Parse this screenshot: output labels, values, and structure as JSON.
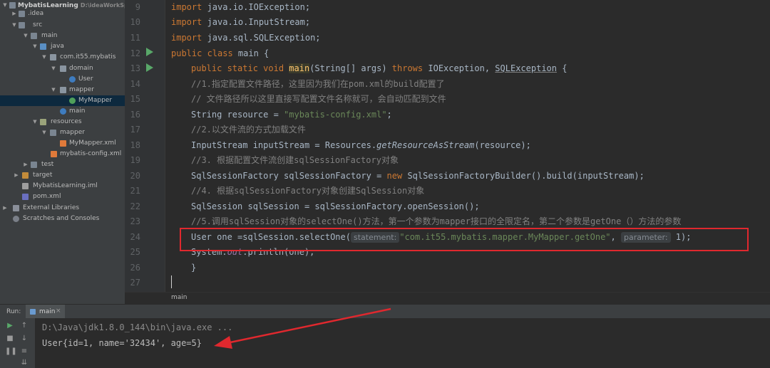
{
  "project_tree": {
    "items": [
      {
        "label": "MybatisLearning",
        "sub": "D:\\ideaWorkSp",
        "icon": "folder-icon"
      },
      {
        "label": ".idea",
        "icon": "folder-icon"
      },
      {
        "label": "src",
        "icon": "folder-icon"
      },
      {
        "label": "main",
        "icon": "folder-icon"
      },
      {
        "label": "java",
        "icon": "source-folder-icon"
      },
      {
        "label": "com.it55.mybatis",
        "icon": "package-icon"
      },
      {
        "label": "domain",
        "icon": "package-icon"
      },
      {
        "label": "User",
        "icon": "class-icon"
      },
      {
        "label": "mapper",
        "icon": "package-icon"
      },
      {
        "label": "MyMapper",
        "icon": "interface-icon"
      },
      {
        "label": "main",
        "icon": "class-icon"
      },
      {
        "label": "resources",
        "icon": "resources-folder-icon"
      },
      {
        "label": "mapper",
        "icon": "folder-icon"
      },
      {
        "label": "MyMapper.xml",
        "icon": "xml-file-icon"
      },
      {
        "label": "mybatis-config.xml",
        "icon": "xml-file-icon"
      },
      {
        "label": "test",
        "icon": "folder-icon"
      },
      {
        "label": "target",
        "icon": "excluded-folder-icon"
      },
      {
        "label": "MybatisLearning.iml",
        "icon": "iml-file-icon"
      },
      {
        "label": "pom.xml",
        "icon": "maven-file-icon"
      },
      {
        "label": "External Libraries",
        "icon": "library-icon"
      },
      {
        "label": "Scratches and Consoles",
        "icon": "scratch-icon"
      }
    ]
  },
  "editor": {
    "line_numbers": [
      "9",
      "10",
      "11",
      "12",
      "13",
      "14",
      "15",
      "16",
      "17",
      "18",
      "19",
      "20",
      "21",
      "22",
      "23",
      "24",
      "25",
      "26",
      "27"
    ],
    "code": {
      "l9_kw": "import",
      "l9_rest": " java.io.IOException;",
      "l10_kw": "import",
      "l10_rest": " java.io.InputStream;",
      "l11_kw": "import",
      "l11_rest": " java.sql.SQLException;",
      "l12_kw": "public class",
      "l12_rest": " main {",
      "l13_kw": "public static void",
      "l13_method": "main",
      "l13_params": "(String[] args) ",
      "l13_throws": "throws",
      "l13_exc1": " IOException, ",
      "l13_exc2": "SQLException",
      "l13_end": " {",
      "l14": "//1.指定配置文件路径，这里因为我们在pom.xml的build配置了",
      "l15": "// 文件路径所以这里直接写配置文件名称就可，会自动匹配到文件",
      "l16_a": "String resource = ",
      "l16_str": "\"mybatis-config.xml\"",
      "l16_b": ";",
      "l17": "//2.以文件流的方式加载文件",
      "l18_a": "InputStream inputStream = Resources.",
      "l18_method": "getResourceAsStream",
      "l18_b": "(resource);",
      "l19": "//3. 根据配置文件流创建sqlSessionFactory对象",
      "l20_a": "SqlSessionFactory sqlSessionFactory = ",
      "l20_kw": "new",
      "l20_b": " SqlSessionFactoryBuilder().build(inputStream);",
      "l21": "//4. 根据sqlSessionFactory对象创建SqlSession对象",
      "l22": "SqlSession sqlSession = sqlSessionFactory.openSession();",
      "l23": "//5.调用sqlSession对象的selectOne()方法，第一个参数为mapper接口的全限定名，第二个参数是getOne（）方法的参数",
      "l24_a": "User one =sqlSession.selectOne(",
      "l24_hint1": "statement:",
      "l24_str": "\"com.it55.mybatis.mapper.MyMapper.getOne\"",
      "l24_comma": ", ",
      "l24_hint2": "parameter:",
      "l24_b": " 1);",
      "l25_a": "System.",
      "l25_field": "out",
      "l25_b": ".println(one);",
      "l26": "}"
    }
  },
  "breadcrumb": {
    "label": "main"
  },
  "run_panel": {
    "label": "Run:",
    "tab_label": "main",
    "tab_close": "×",
    "console": {
      "command": "D:\\Java\\jdk1.8.0_144\\bin\\java.exe ...",
      "output": "User{id=1, name='32434', age=5}"
    }
  },
  "colors": {
    "annotation_red": "#e0282e",
    "run_green": "#59a869"
  }
}
